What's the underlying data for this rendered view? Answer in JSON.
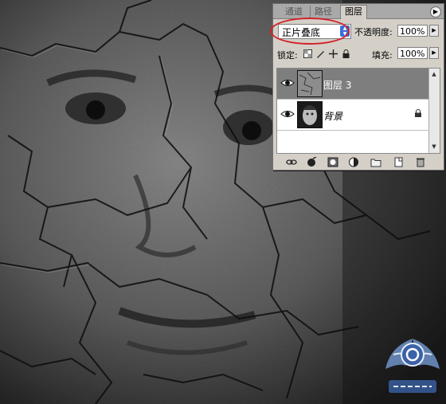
{
  "panel": {
    "tabs": [
      {
        "label": "通道"
      },
      {
        "label": "路径"
      },
      {
        "label": "图层"
      }
    ],
    "blend_mode": {
      "value": "正片叠底"
    },
    "opacity": {
      "label": "不透明度:",
      "value": "100%"
    },
    "lock": {
      "label": "锁定:"
    },
    "fill": {
      "label": "填充:",
      "value": "100%"
    },
    "layers": [
      {
        "name": "图层 3",
        "selected": true,
        "visible": true
      },
      {
        "name": "背景",
        "selected": false,
        "visible": true,
        "locked": true
      }
    ],
    "footer_icons": [
      "link-icon",
      "fx-icon",
      "mask-icon",
      "adjustment-icon",
      "folder-icon",
      "new-layer-icon",
      "trash-icon"
    ]
  },
  "watermark": {
    "logo": "site-logo"
  },
  "colors": {
    "panel_bg": "#d4d0c8",
    "selected_row": "#7e7e7e",
    "highlight_ring": "#d3222a",
    "spinner_blue": "#3a6fd9"
  }
}
